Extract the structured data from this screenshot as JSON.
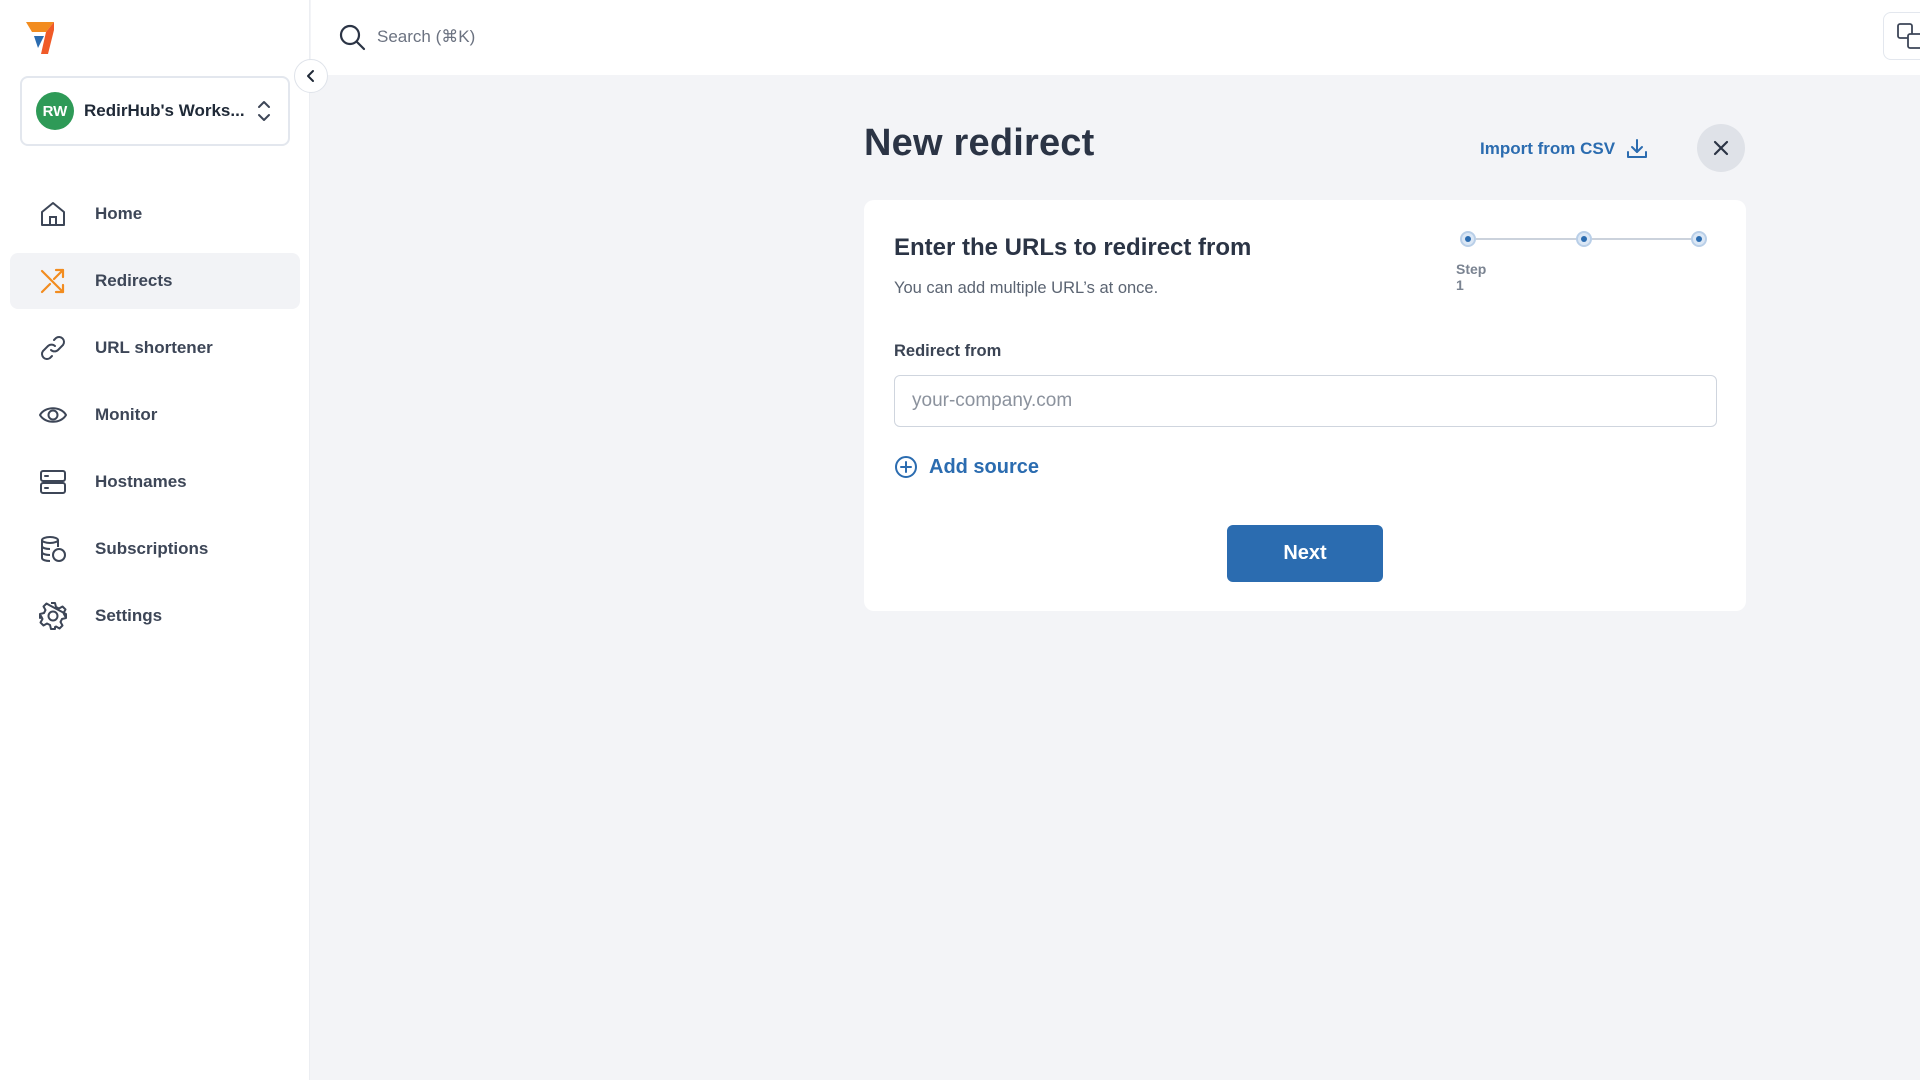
{
  "sidebar": {
    "logo": "redirhub-logo",
    "workspace": {
      "initials": "RW",
      "name": "RedirHub's Works...",
      "avatar_color": "#2e9a57"
    },
    "items": [
      {
        "label": "Home",
        "icon": "home-icon",
        "active": false
      },
      {
        "label": "Redirects",
        "icon": "redirects-icon",
        "active": true
      },
      {
        "label": "URL shortener",
        "icon": "link-icon",
        "active": false
      },
      {
        "label": "Monitor",
        "icon": "eye-icon",
        "active": false
      },
      {
        "label": "Hostnames",
        "icon": "server-icon",
        "active": false
      },
      {
        "label": "Subscriptions",
        "icon": "subscriptions-icon",
        "active": false
      },
      {
        "label": "Settings",
        "icon": "gear-icon",
        "active": false
      }
    ]
  },
  "topbar": {
    "search_placeholder": "Search (⌘K)"
  },
  "main": {
    "title": "New redirect",
    "import_label": "Import from CSV",
    "card": {
      "title": "Enter the URLs to redirect from",
      "subtitle": "You can add multiple URL’s at once.",
      "stepper": {
        "current_label": "Step 1",
        "total_steps": 3,
        "current_step": 1
      },
      "field_label": "Redirect from",
      "field_placeholder": "your-company.com",
      "field_value": "",
      "add_source_label": "Add source",
      "next_label": "Next"
    }
  },
  "colors": {
    "accent": "#2b6cb0",
    "active_icon": "#f28c1f",
    "background": "#f3f4f7"
  }
}
